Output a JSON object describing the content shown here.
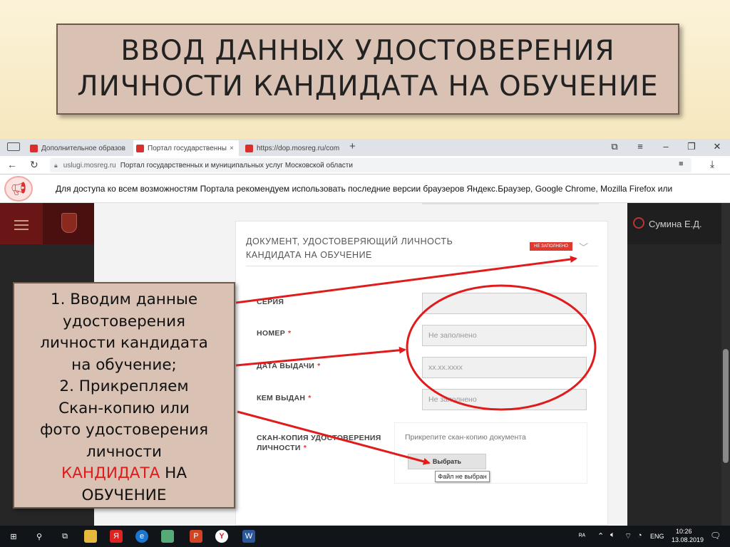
{
  "slide": {
    "title_line1": "ВВОД ДАННЫХ УДОСТОВЕРЕНИЯ",
    "title_line2": "ЛИЧНОСТИ КАНДИДАТА НА ОБУЧЕНИЕ"
  },
  "browser": {
    "tabs": [
      {
        "label": "Дополнительное образов"
      },
      {
        "label": "Портал государственны",
        "close": "×"
      },
      {
        "label": "https://dop.mosreg.ru/com"
      }
    ],
    "new_tab": "+",
    "address_domain": "uslugi.mosreg.ru",
    "address_title": "Портал государственных и муниципальных услуг Московской области",
    "notice": "Для доступа ко всем возможностям Портала рекомендуем использовать последние версии браузеров Яндекс.Браузер, Google Chrome, Mozilla Firefox или"
  },
  "portal": {
    "user_name": "Сумина Е.Д.",
    "section_title_line1": "ДОКУМЕНТ, УДОСТОВЕРЯЮЩИЙ ЛИЧНОСТЬ",
    "section_title_line2": "КАНДИДАТА НА ОБУЧЕНИЕ",
    "status_badge": "НЕ ЗАПОЛНЕНО",
    "fields": [
      {
        "label": "СЕРИЯ",
        "required": false,
        "value": ""
      },
      {
        "label": "НОМЕР",
        "required": true,
        "placeholder": "Не заполнено"
      },
      {
        "label": "ДАТА ВЫДАЧИ",
        "required": true,
        "placeholder": "xx.xx.xxxx"
      },
      {
        "label": "КЕМ ВЫДАН",
        "required": true,
        "placeholder": "Не заполнено"
      }
    ],
    "scan_label_line1": "СКАН-КОПИЯ УДОСТОВЕРЕНИЯ",
    "scan_label_line2": "ЛИЧНОСТИ",
    "required_mark": "*",
    "upload_hint": "Прикрепите скан-копию документа",
    "choose_button": "Выбрать",
    "no_file_tooltip": "Файл не выбран"
  },
  "instructions": {
    "line1": "1. Вводим данные",
    "line2": "удостоверения",
    "line3": "личности кандидата",
    "line4": "на обучение;",
    "line5": "2. Прикрепляем",
    "line6": "Скан-копию или",
    "line7": "фото удостоверения",
    "line8": "личности",
    "line9_red": "КАНДИДАТА",
    "line9_rest": " НА",
    "line10": "ОБУЧЕНИЕ"
  },
  "taskbar": {
    "lang": "ENG",
    "time": "10:26",
    "date": "13.08.2019"
  },
  "colors": {
    "accent_red": "#e01b1b",
    "box_fill": "#d9c2b4",
    "badge_red": "#e03a30"
  }
}
